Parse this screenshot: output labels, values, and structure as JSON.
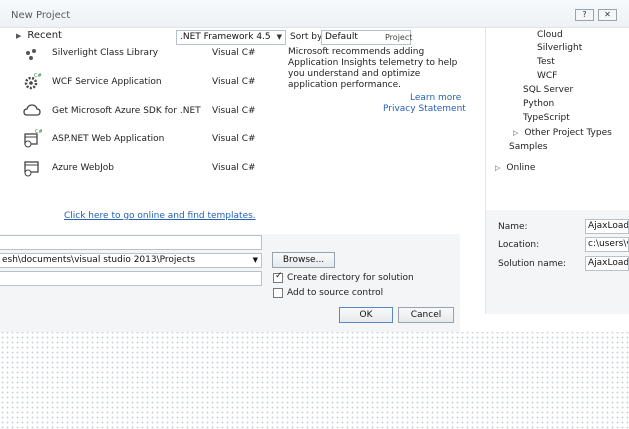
{
  "dialog": {
    "title": "New Project",
    "help_btn": "?",
    "close_btn": "✕"
  },
  "left_nav": {
    "recent": "Recent"
  },
  "toolbar": {
    "framework": ".NET Framework 4.5",
    "sort_label": "Sort by:",
    "sort_value": "Default",
    "search_hint": "Project"
  },
  "templates": [
    {
      "name": "Silverlight Class Library",
      "lang": "Visual C#",
      "icon": "silverlight-icon"
    },
    {
      "name": "WCF Service Application",
      "lang": "Visual C#",
      "icon": "wcf-gear-icon"
    },
    {
      "name": "Get Microsoft Azure SDK for .NET",
      "lang": "Visual C#",
      "icon": "cloud-icon"
    },
    {
      "name": "ASP.NET Web Application",
      "lang": "Visual C#",
      "icon": "web-app-icon"
    },
    {
      "name": "Azure WebJob",
      "lang": "Visual C#",
      "icon": "webjob-icon"
    }
  ],
  "online_link": "Click here to go online and find templates.",
  "description": {
    "text": "Microsoft recommends adding Application Insights telemetry to help you understand and optimize application performance.",
    "learn_more": "Learn more",
    "privacy": "Privacy Statement"
  },
  "tree": {
    "cloud": "Cloud",
    "silverlight": "Silverlight",
    "test": "Test",
    "wcf": "WCF",
    "sql": "SQL Server",
    "python": "Python",
    "typescript": "TypeScript",
    "other": "Other Project Types",
    "samples": "Samples",
    "online": "Online"
  },
  "form": {
    "location_path": "esh\\documents\\visual studio 2013\\Projects",
    "browse": "Browse...",
    "create_dir": "Create directory for solution",
    "add_source": "Add to source control",
    "ok": "OK",
    "cancel": "Cancel"
  },
  "props": {
    "name_label": "Name:",
    "name_value": "AjaxLoader",
    "location_label": "Location:",
    "location_value": "c:\\users\\vig",
    "solution_label": "Solution name:",
    "solution_value": "AjaxLoader"
  }
}
